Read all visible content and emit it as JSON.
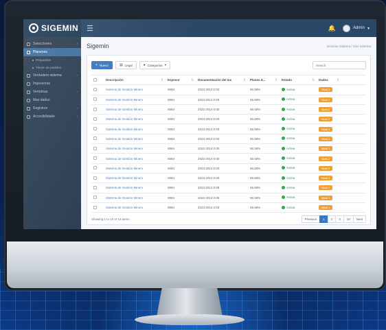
{
  "app": {
    "brand": "SIGEMIN",
    "user_name": "Admin"
  },
  "sidebar": {
    "items": [
      {
        "label": "Selecciones",
        "active": false,
        "chevron": true
      },
      {
        "label": "Planenes",
        "active": true,
        "chevron": true
      },
      {
        "label": "Preparatas",
        "active": false,
        "sub": true
      },
      {
        "label": "Tienen de pedidos",
        "active": false,
        "sub": true
      },
      {
        "label": "Verdadero sistema",
        "active": false,
        "chevron": true
      },
      {
        "label": "Impresoras",
        "active": false,
        "chevron": false
      },
      {
        "label": "Vertebras",
        "active": false,
        "chevron": true
      },
      {
        "label": "Mas dados",
        "active": false,
        "chevron": false
      },
      {
        "label": "Registros",
        "active": false,
        "chevron": true
      },
      {
        "label": "Accesibilidade",
        "active": false,
        "chevron": true
      }
    ]
  },
  "page": {
    "title": "Sigemin",
    "breadcrumb": "Dominio Sistema  /  Sitio Sistema"
  },
  "toolbar": {
    "primary_label": "Nuevo",
    "legal_label": "Legal",
    "categories_label": "Categorías",
    "search_placeholder": "Search"
  },
  "table": {
    "columns": [
      "Descripción",
      "Espesor",
      "Documentación del Inc",
      "Planes d...",
      "Estado",
      "Dados"
    ],
    "rows": [
      {
        "name": "Sistema de Gestión Minero",
        "code": "0084",
        "date": "2023 2014 0:00",
        "value": "55.58%",
        "status": "Activa",
        "badge": "Nivel 1"
      },
      {
        "name": "Sistema de Gestión Minero",
        "code": "0084",
        "date": "2023 2014 0:00",
        "value": "55.58%",
        "status": "Activa",
        "badge": "Nivel 1"
      },
      {
        "name": "Sistema de Gestión Minero",
        "code": "0084",
        "date": "2023 2014 0:00",
        "value": "55.58%",
        "status": "Activa",
        "badge": "Nivel 1"
      },
      {
        "name": "Sistema de Gestión Minero",
        "code": "0084",
        "date": "2023 2014 0:00",
        "value": "55.58%",
        "status": "Activa",
        "badge": "Nivel 1"
      },
      {
        "name": "Sistema de Gestión Minero",
        "code": "0084",
        "date": "2023 2014 0:00",
        "value": "55.58%",
        "status": "Activa",
        "badge": "Nivel 1"
      },
      {
        "name": "Sistema de Gestión Minero",
        "code": "0084",
        "date": "2023 2014 0:00",
        "value": "55.58%",
        "status": "Activa",
        "badge": "Nivel 1"
      },
      {
        "name": "Sistema de Gestión Minero",
        "code": "0084",
        "date": "2023 2014 0:00",
        "value": "55.58%",
        "status": "Activa",
        "badge": "Nivel 1"
      },
      {
        "name": "Sistema de Gestión Minero",
        "code": "0084",
        "date": "2023 2014 0:00",
        "value": "55.58%",
        "status": "Activa",
        "badge": "Nivel 1"
      },
      {
        "name": "Sistema de Gestión Minero",
        "code": "0084",
        "date": "2023 2014 0:00",
        "value": "55.58%",
        "status": "Activa",
        "badge": "Nivel 1"
      },
      {
        "name": "Sistema de Gestión Minero",
        "code": "0084",
        "date": "2023 2014 0:00",
        "value": "55.58%",
        "status": "Activa",
        "badge": "Nivel 1"
      },
      {
        "name": "Sistema de Gestión Minero",
        "code": "0084",
        "date": "2023 2014 0:08",
        "value": "55.58%",
        "status": "Activa",
        "badge": "Nivel 1"
      },
      {
        "name": "Sistema de Gestión Minero",
        "code": "0084",
        "date": "2023 2014 0:08",
        "value": "55.58%",
        "status": "Activa",
        "badge": "Nivel 1"
      },
      {
        "name": "Sistema de Gestión Minero",
        "code": "0084",
        "date": "2023 2014 0:00",
        "value": "55.58%",
        "status": "Activa",
        "badge": "Nivel 1"
      }
    ]
  },
  "footer": {
    "showing": "Showing 1 to 10 of 13 items",
    "pagination": [
      "Previous",
      "1",
      "2",
      "3",
      "10",
      "Next"
    ],
    "active_page": "1"
  },
  "colors": {
    "accent": "#3a78c2",
    "sidebar": "#2c3e52",
    "badge": "#f0a033",
    "status": "#3aa15a"
  }
}
